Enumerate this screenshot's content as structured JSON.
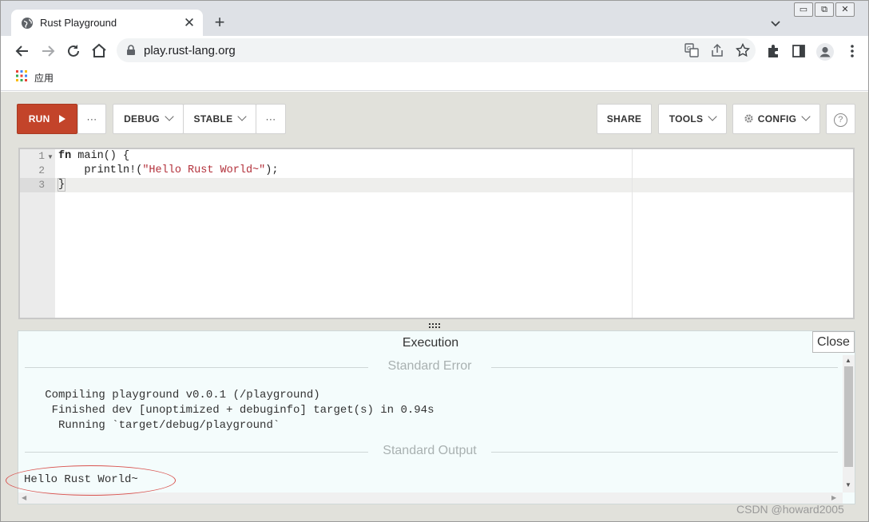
{
  "browser": {
    "tab": {
      "title": "Rust Playground",
      "close_glyph": "✕"
    },
    "new_tab_glyph": "+",
    "window_controls": [
      "▭",
      "⧉",
      "✕"
    ],
    "omnibox": {
      "url": "play.rust-lang.org"
    },
    "bookmarks": [
      {
        "label": "应用",
        "icon": "apps-grid-icon"
      }
    ]
  },
  "playground": {
    "toolbar": {
      "run_label": "RUN",
      "more_glyph": "···",
      "mode_label": "DEBUG",
      "channel_label": "STABLE",
      "share_label": "SHARE",
      "tools_label": "TOOLS",
      "config_label": "CONFIG",
      "help_glyph": "?"
    },
    "editor": {
      "line_numbers": [
        "1",
        "2",
        "3"
      ],
      "lines": [
        [
          {
            "t": "fn",
            "c": "kw"
          },
          {
            "t": " main() {",
            "c": ""
          }
        ],
        [
          {
            "t": "    println!(",
            "c": ""
          },
          {
            "t": "\"Hello Rust World~\"",
            "c": "str"
          },
          {
            "t": ");",
            "c": ""
          }
        ],
        [
          {
            "t": "}",
            "c": ""
          }
        ]
      ]
    },
    "output": {
      "title": "Execution",
      "close_label": "Close",
      "stderr_label": "Standard Error",
      "stderr_lines": [
        "   Compiling playground v0.0.1 (/playground)",
        "    Finished dev [unoptimized + debuginfo] target(s) in 0.94s",
        "     Running `target/debug/playground`"
      ],
      "stdout_label": "Standard Output",
      "stdout_lines": [
        "Hello Rust World~"
      ]
    }
  },
  "watermark": "CSDN @howard2005",
  "colors": {
    "run_button": "#c3442a",
    "page_bg": "#e1e1db",
    "output_bg": "#f4fcfc",
    "string": "#b3313b",
    "annotation": "#d9534f"
  }
}
